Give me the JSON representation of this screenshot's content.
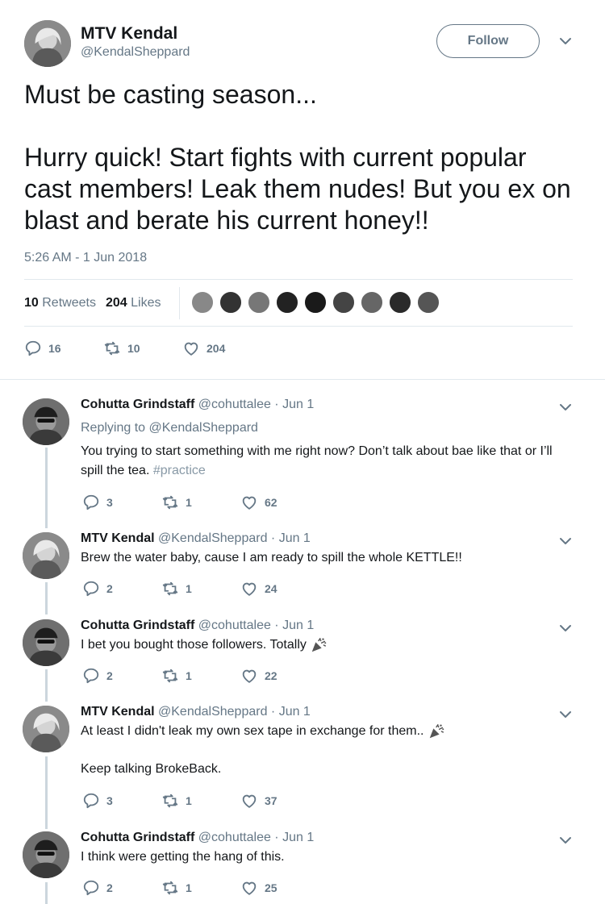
{
  "tweet": {
    "author_name": "MTV Kendal",
    "author_handle": "@KendalSheppard",
    "follow_label": "Follow",
    "text": "Must be casting season...\n\nHurry quick! Start fights with current popular cast members! Leak them nudes! But you ex on blast and berate his current honey!!",
    "timestamp": "5:26 AM - 1 Jun 2018",
    "retweets_count": "10",
    "retweets_label": "Retweets",
    "likes_count": "204",
    "likes_label": "Likes",
    "actions": {
      "replies": "16",
      "retweets": "10",
      "likes": "204"
    }
  },
  "replies": [
    {
      "name": "Cohutta Grindstaff",
      "meta": "@cohuttalee · Jun 1",
      "replying_prefix": "Replying to",
      "replying_to": "@KendalSheppard",
      "text": "You trying to start something with me right now? Don’t talk about bae like that or I’ll spill the tea.",
      "hashtag": "#practice",
      "replies": "3",
      "retweets": "1",
      "likes": "62"
    },
    {
      "name": "MTV Kendal",
      "meta": "@KendalSheppard · Jun 1",
      "text": "Brew the water baby, cause I am ready to spill the whole KETTLE!!",
      "replies": "2",
      "retweets": "1",
      "likes": "24"
    },
    {
      "name": "Cohutta Grindstaff",
      "meta": "@cohuttalee · Jun 1",
      "text": "I bet you bought those followers. Totally",
      "replies": "2",
      "retweets": "1",
      "likes": "22"
    },
    {
      "name": "MTV Kendal",
      "meta": "@KendalSheppard · Jun 1",
      "text": "At least I didn't leak my own sex tape in exchange for them..",
      "text2": "Keep talking BrokeBack.",
      "replies": "3",
      "retweets": "1",
      "likes": "37"
    },
    {
      "name": "Cohutta Grindstaff",
      "meta": "@cohuttalee · Jun 1",
      "text": "I think were getting the hang of this.",
      "replies": "2",
      "retweets": "1",
      "likes": "25"
    }
  ],
  "icons": {
    "reply": "reply-icon",
    "retweet": "retweet-icon",
    "like": "heart-icon",
    "caret": "chevron-down-icon",
    "emoji": "party-popper-icon"
  },
  "colors": {
    "text": "#14171a",
    "secondary": "#657786",
    "divider": "#e1e8ed"
  }
}
